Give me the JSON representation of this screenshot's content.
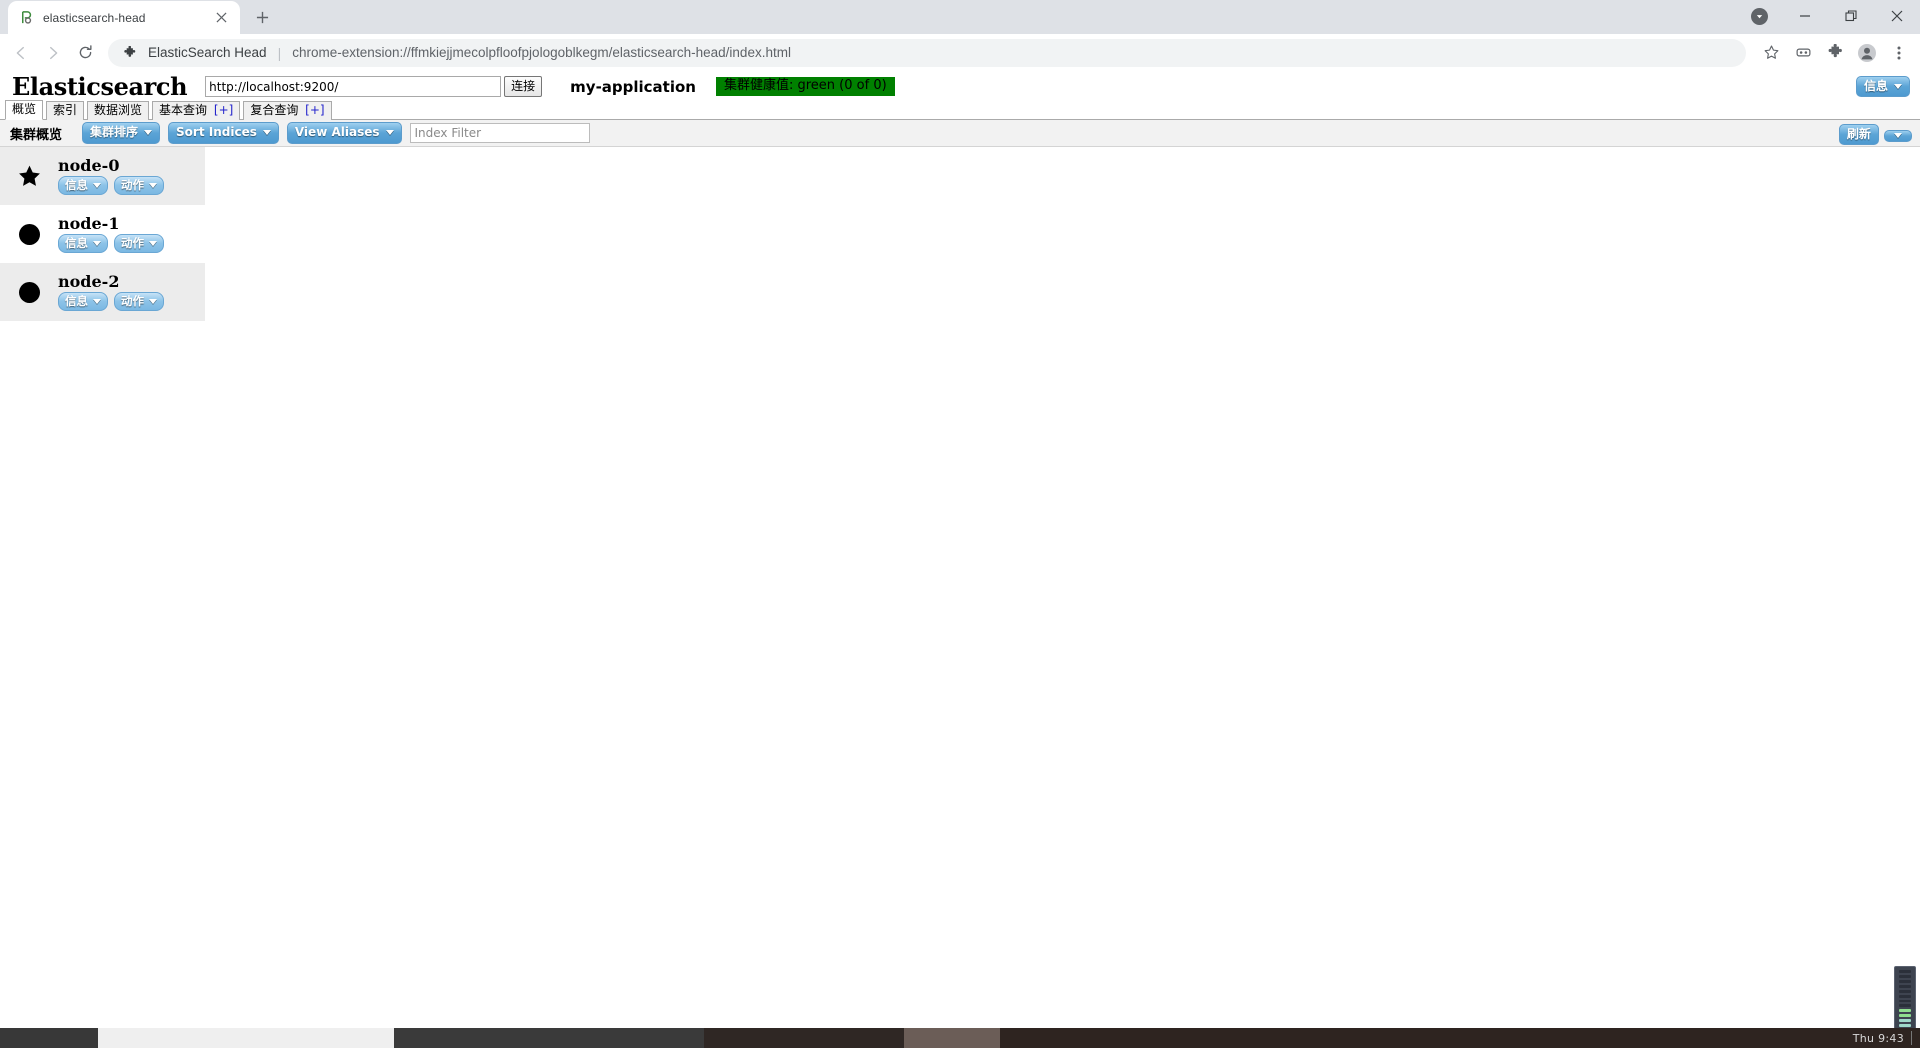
{
  "browser": {
    "tab": {
      "title": "elasticsearch-head",
      "favicon_icon": "elasticsearch-head-favicon",
      "close_icon": "close-icon"
    },
    "newtab_icon": "plus-icon",
    "window_controls": {
      "update_icon": "update-badge-icon",
      "minimize_icon": "minimize-icon",
      "maximize_icon": "maximize-restore-icon",
      "close_icon": "window-close-icon"
    },
    "nav": {
      "back_icon": "back-arrow-icon",
      "forward_icon": "forward-arrow-icon",
      "reload_icon": "reload-icon"
    },
    "omnibox": {
      "extension_icon": "puzzle-piece-icon",
      "scheme_label": "ElasticSearch Head",
      "separator": "|",
      "url": "chrome-extension://ffmkiejjmecolpfloofpjologoblkegm/elasticsearch-head/index.html"
    },
    "toolbar_icons": [
      {
        "name": "bookmark-star-icon"
      },
      {
        "name": "reading-list-icon"
      },
      {
        "name": "extensions-puzzle-icon"
      },
      {
        "name": "profile-avatar-icon"
      },
      {
        "name": "chrome-menu-kebab-icon"
      }
    ]
  },
  "app": {
    "logo": "Elasticsearch",
    "host": {
      "value": "http://localhost:9200/",
      "placeholder": "http://localhost:9200/"
    },
    "connect_label": "连接",
    "cluster_name": "my-application",
    "health": {
      "text": "集群健康值: green (0 of 0)",
      "color": "#008000",
      "status": "green",
      "shards": "0 of 0"
    },
    "header_info_label": "信息",
    "tabs": [
      {
        "label": "概览",
        "plus": "",
        "active": true
      },
      {
        "label": "索引",
        "plus": "",
        "active": false
      },
      {
        "label": "数据浏览",
        "plus": "",
        "active": false
      },
      {
        "label": "基本查询",
        "plus": "[+]",
        "active": false
      },
      {
        "label": "复合查询",
        "plus": "[+]",
        "active": false
      }
    ],
    "toolbar": {
      "title": "集群概览",
      "sort_cluster_label": "集群排序",
      "sort_indices_label": "Sort Indices",
      "view_aliases_label": "View Aliases",
      "index_filter_placeholder": "Index Filter",
      "index_filter_value": "",
      "refresh_label": "刷新"
    },
    "node_button_labels": {
      "info": "信息",
      "actions": "动作"
    },
    "nodes": [
      {
        "name": "node-0",
        "marker": "star",
        "master": true
      },
      {
        "name": "node-1",
        "marker": "circle",
        "master": false
      },
      {
        "name": "node-2",
        "marker": "circle",
        "master": false
      }
    ]
  },
  "desktop": {
    "clock": "Thu 9:43"
  }
}
